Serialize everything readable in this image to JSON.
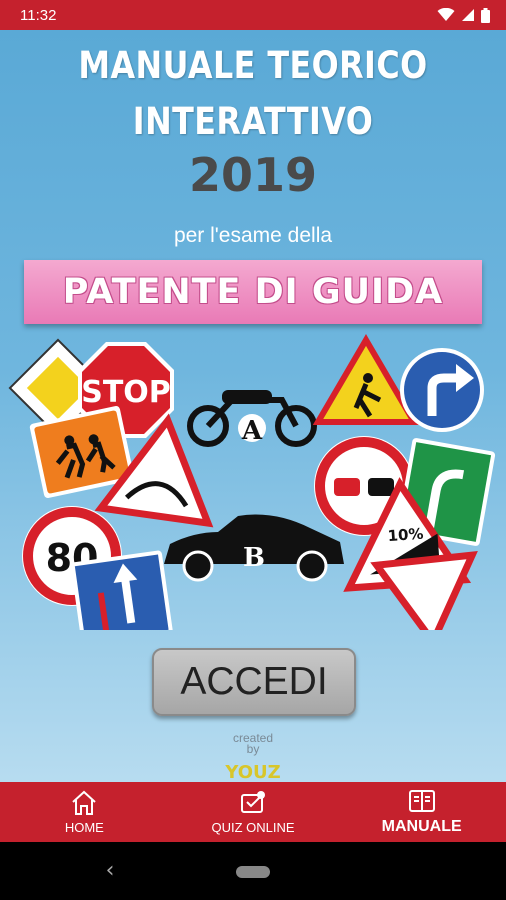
{
  "status_bar": {
    "time": "11:32"
  },
  "header": {
    "title_line1": "MANUALE TEORICO",
    "title_line2": "INTERATTIVO",
    "year": "2019",
    "subtitle": "per l'esame della",
    "banner": "PATENTE DI GUIDA"
  },
  "signs": {
    "stop": "STOP",
    "speed_limit": "80",
    "grade": "10%",
    "category_a": "A",
    "category_b": "B"
  },
  "actions": {
    "enter_label": "ACCEDI"
  },
  "credit": {
    "line1": "created",
    "line2": "by",
    "logo": "YOUZ"
  },
  "bottom_nav": {
    "items": [
      {
        "label": "HOME",
        "icon": "home-icon"
      },
      {
        "label": "QUIZ ONLINE",
        "icon": "quiz-icon"
      },
      {
        "label": "MANUALE",
        "icon": "manual-icon",
        "active": true
      }
    ]
  },
  "colors": {
    "accent": "#c5212d",
    "banner_pink": "#e97ab6",
    "sky": "#6fb6de"
  }
}
